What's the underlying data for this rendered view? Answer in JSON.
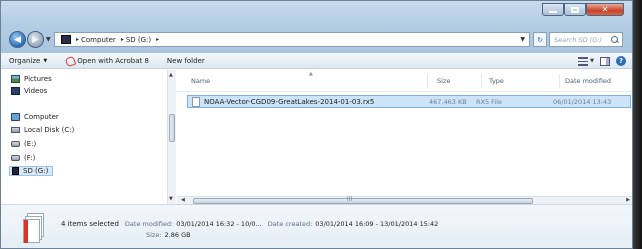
{
  "address": {
    "crumbs": [
      "Computer",
      "SD (G:)"
    ],
    "search_placeholder": "Search SD (G:)"
  },
  "commands": {
    "organize": "Organize",
    "open_with": "Open with Acrobat 8",
    "new_folder": "New folder"
  },
  "nav": {
    "items": [
      {
        "label": "Pictures",
        "icon": "pictures-icon"
      },
      {
        "label": "Videos",
        "icon": "videos-icon"
      },
      {
        "label": "Computer",
        "icon": "computer-icon"
      },
      {
        "label": "Local Disk (C:)",
        "icon": "disk-icon"
      },
      {
        "label": "(E:)",
        "icon": "removable-icon"
      },
      {
        "label": "(F:)",
        "icon": "removable-icon"
      },
      {
        "label": "SD (G:)",
        "icon": "sd-icon"
      }
    ]
  },
  "columns": {
    "name": "Name",
    "size": "Size",
    "type": "Type",
    "date": "Date modified"
  },
  "files": [
    {
      "name": "NOAA-Vector-CGD09-GreatLakes-2014-01-03.rx5",
      "size": "467,463 KB",
      "type": "RX5 File",
      "date": "06/01/2014 13:43"
    }
  ],
  "details": {
    "selection": "4 items selected",
    "modified_label": "Date modified:",
    "modified_value": "03/01/2014 16:32 - 10/0...",
    "created_label": "Date created:",
    "created_value": "03/01/2014 16:09 - 13/01/2014 15:42",
    "size_label": "Size:",
    "size_value": "2.86 GB"
  }
}
